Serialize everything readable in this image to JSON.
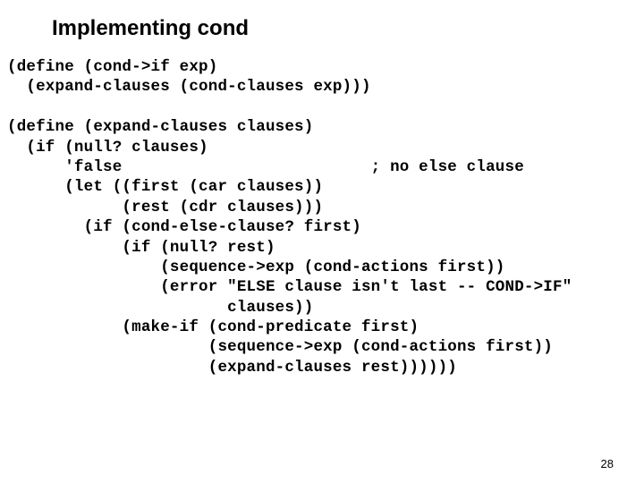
{
  "title": "Implementing cond",
  "code": "(define (cond->if exp)\n  (expand-clauses (cond-clauses exp)))\n\n(define (expand-clauses clauses)\n  (if (null? clauses)\n      'false                          ; no else clause\n      (let ((first (car clauses))\n            (rest (cdr clauses)))\n        (if (cond-else-clause? first)\n            (if (null? rest)\n                (sequence->exp (cond-actions first))\n                (error \"ELSE clause isn't last -- COND->IF\"\n                       clauses))\n            (make-if (cond-predicate first)\n                     (sequence->exp (cond-actions first))\n                     (expand-clauses rest))))))",
  "page_number": "28"
}
